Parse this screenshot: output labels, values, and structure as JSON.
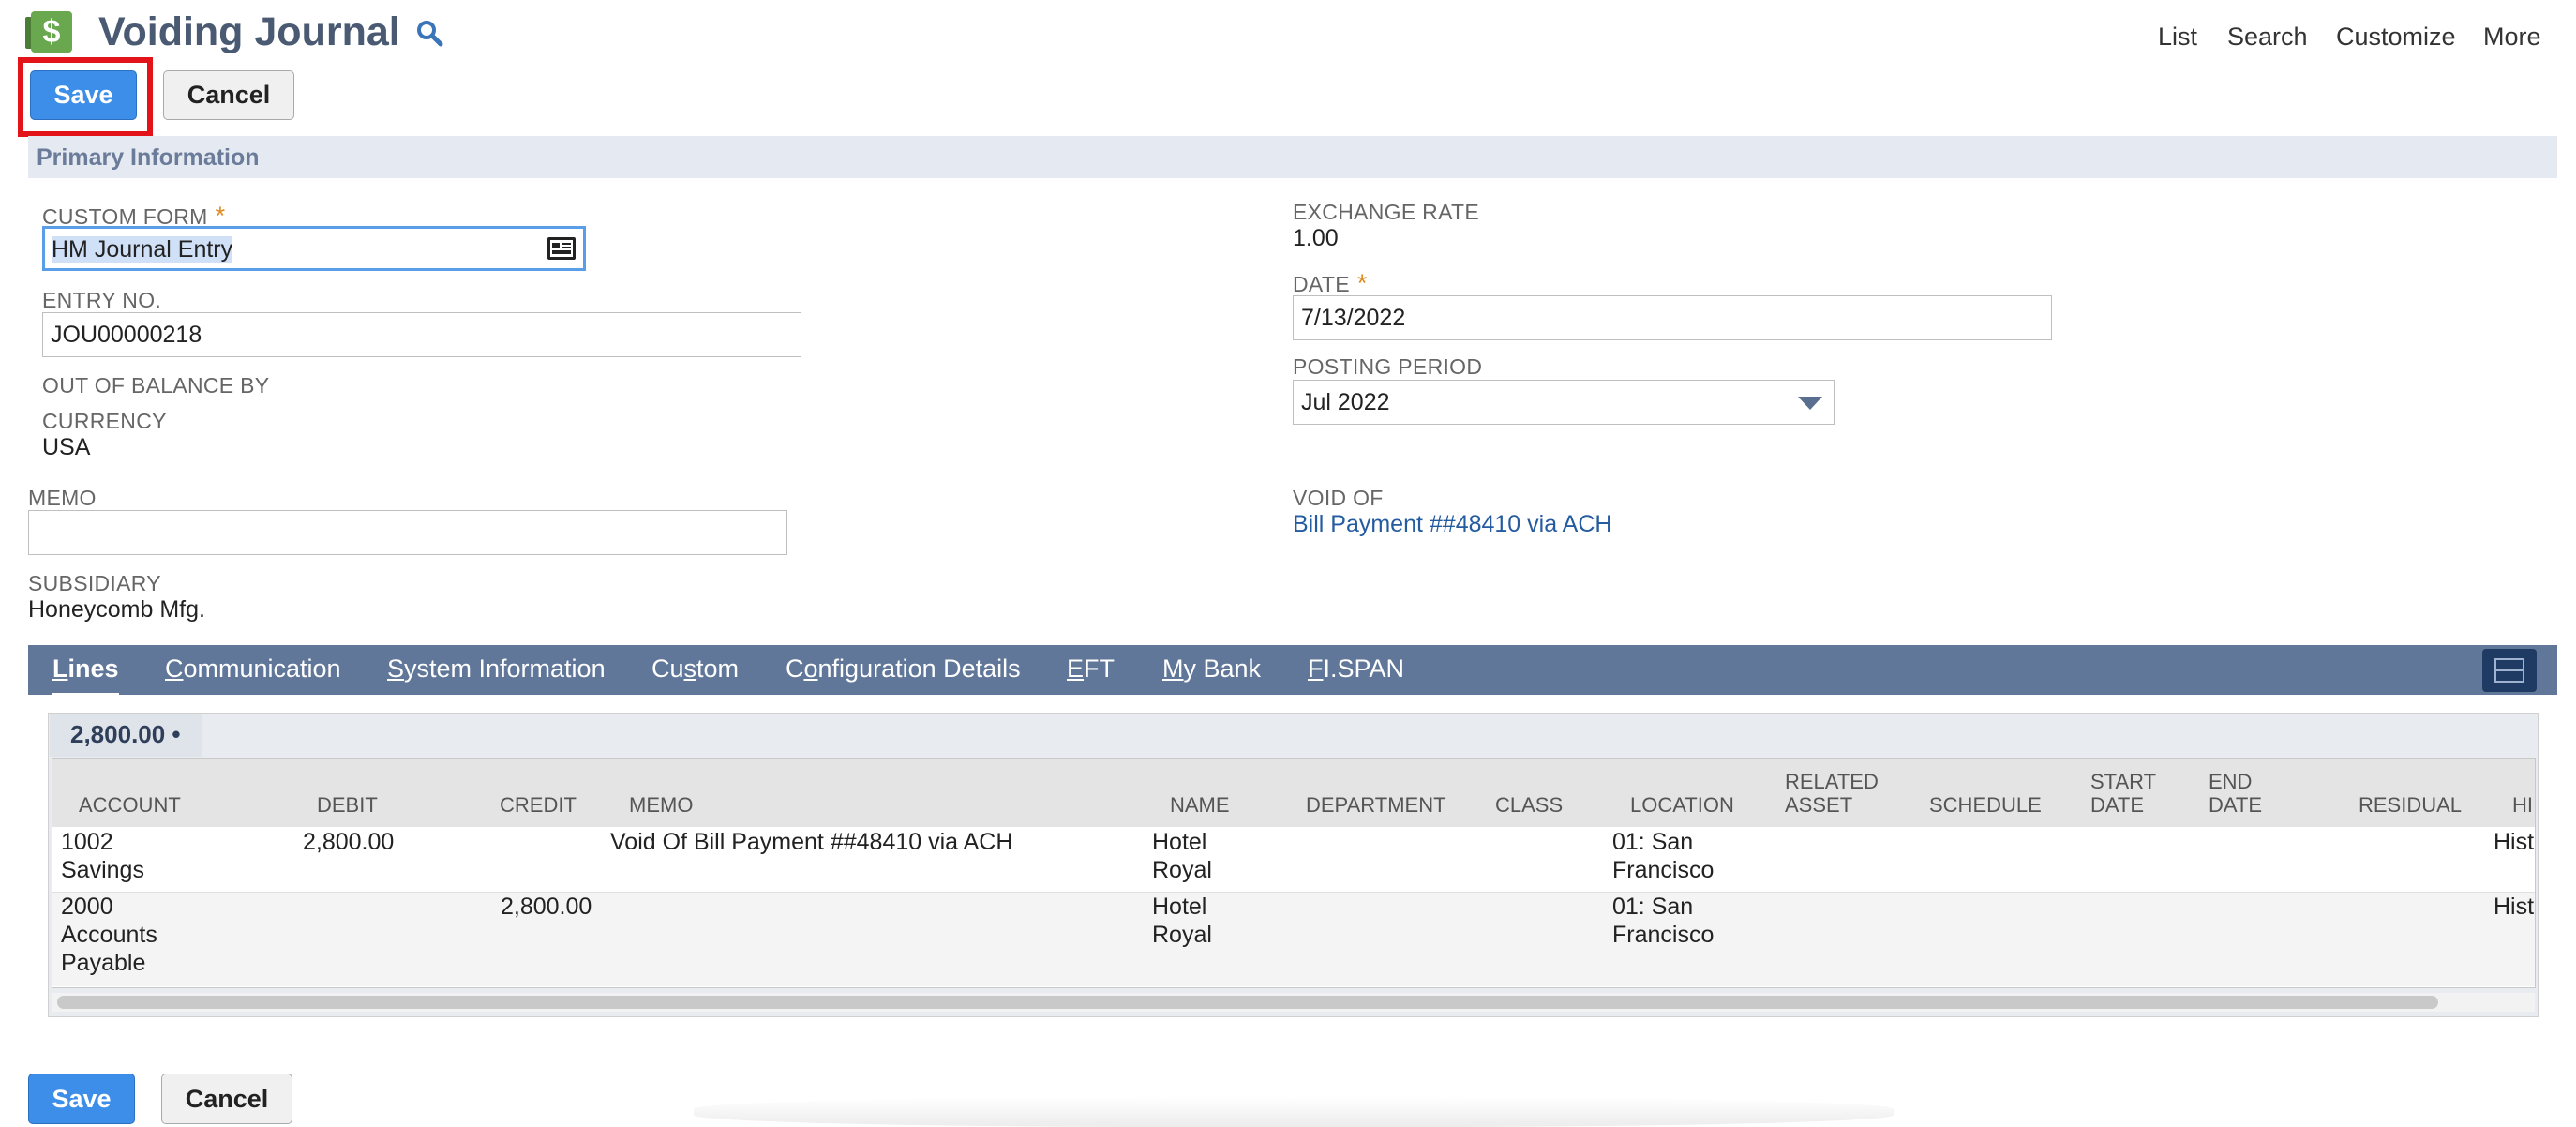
{
  "header": {
    "title": "Voiding Journal",
    "nav": [
      "List",
      "Search",
      "Customize",
      "More"
    ]
  },
  "buttons": {
    "save": "Save",
    "cancel": "Cancel"
  },
  "section": {
    "title": "Primary Information"
  },
  "fields": {
    "custom_form": {
      "label": "CUSTOM FORM",
      "value": "HM Journal Entry"
    },
    "entry_no": {
      "label": "ENTRY NO.",
      "value": "JOU00000218"
    },
    "out_of_balance": {
      "label": "OUT OF BALANCE BY"
    },
    "currency": {
      "label": "CURRENCY",
      "value": "USA"
    },
    "memo": {
      "label": "MEMO",
      "value": ""
    },
    "subsidiary": {
      "label": "SUBSIDIARY",
      "value": "Honeycomb Mfg."
    },
    "exchange_rate": {
      "label": "EXCHANGE RATE",
      "value": "1.00"
    },
    "date": {
      "label": "DATE",
      "value": "7/13/2022"
    },
    "posting_period": {
      "label": "POSTING PERIOD",
      "value": "Jul 2022"
    },
    "void_of": {
      "label": "VOID OF",
      "value": "Bill Payment ##48410 via ACH"
    }
  },
  "tabs": [
    {
      "first": "L",
      "rest": "ines",
      "active": true
    },
    {
      "first": "C",
      "rest": "ommunication",
      "active": false
    },
    {
      "first": "S",
      "rest": "ystem Information",
      "active": false
    },
    {
      "first": "Cu",
      "mid": "s",
      "rest": "tom",
      "active": false
    },
    {
      "first": "C",
      "mid": "o",
      "rest": "nfiguration Details",
      "active": false
    },
    {
      "first": "E",
      "rest": "FT",
      "active": false
    },
    {
      "first": "M",
      "rest": "y Bank",
      "active": false
    },
    {
      "first": "F",
      "rest": "I.SPAN",
      "active": false
    }
  ],
  "lines": {
    "total": "2,800.00 •",
    "columns": [
      "ACCOUNT",
      "DEBIT",
      "CREDIT",
      "MEMO",
      "NAME",
      "DEPARTMENT",
      "CLASS",
      "LOCATION",
      "RELATED ASSET",
      "SCHEDULE",
      "START DATE",
      "END DATE",
      "RESIDUAL",
      "HI"
    ],
    "rows": [
      {
        "account": [
          "1002",
          "Savings"
        ],
        "debit": "2,800.00",
        "credit": "",
        "memo": "Void Of Bill Payment ##48410 via ACH",
        "name": [
          "Hotel",
          "Royal"
        ],
        "location": [
          "01: San",
          "Francisco"
        ],
        "history": "Hist"
      },
      {
        "account": [
          "2000",
          "Accounts",
          "Payable"
        ],
        "debit": "",
        "credit": "2,800.00",
        "memo": "",
        "name": [
          "Hotel",
          "Royal"
        ],
        "location": [
          "01: San",
          "Francisco"
        ],
        "history": "Hist"
      }
    ]
  },
  "colors": {
    "primary_button": "#3d8ee8",
    "tab_bar": "#607799",
    "highlight": "#e2141a",
    "link": "#255b9f"
  },
  "icons": [
    "journal-dollar-icon",
    "search-icon",
    "list-picker-icon",
    "dropdown-arrow-icon",
    "layout-toggle-icon"
  ]
}
